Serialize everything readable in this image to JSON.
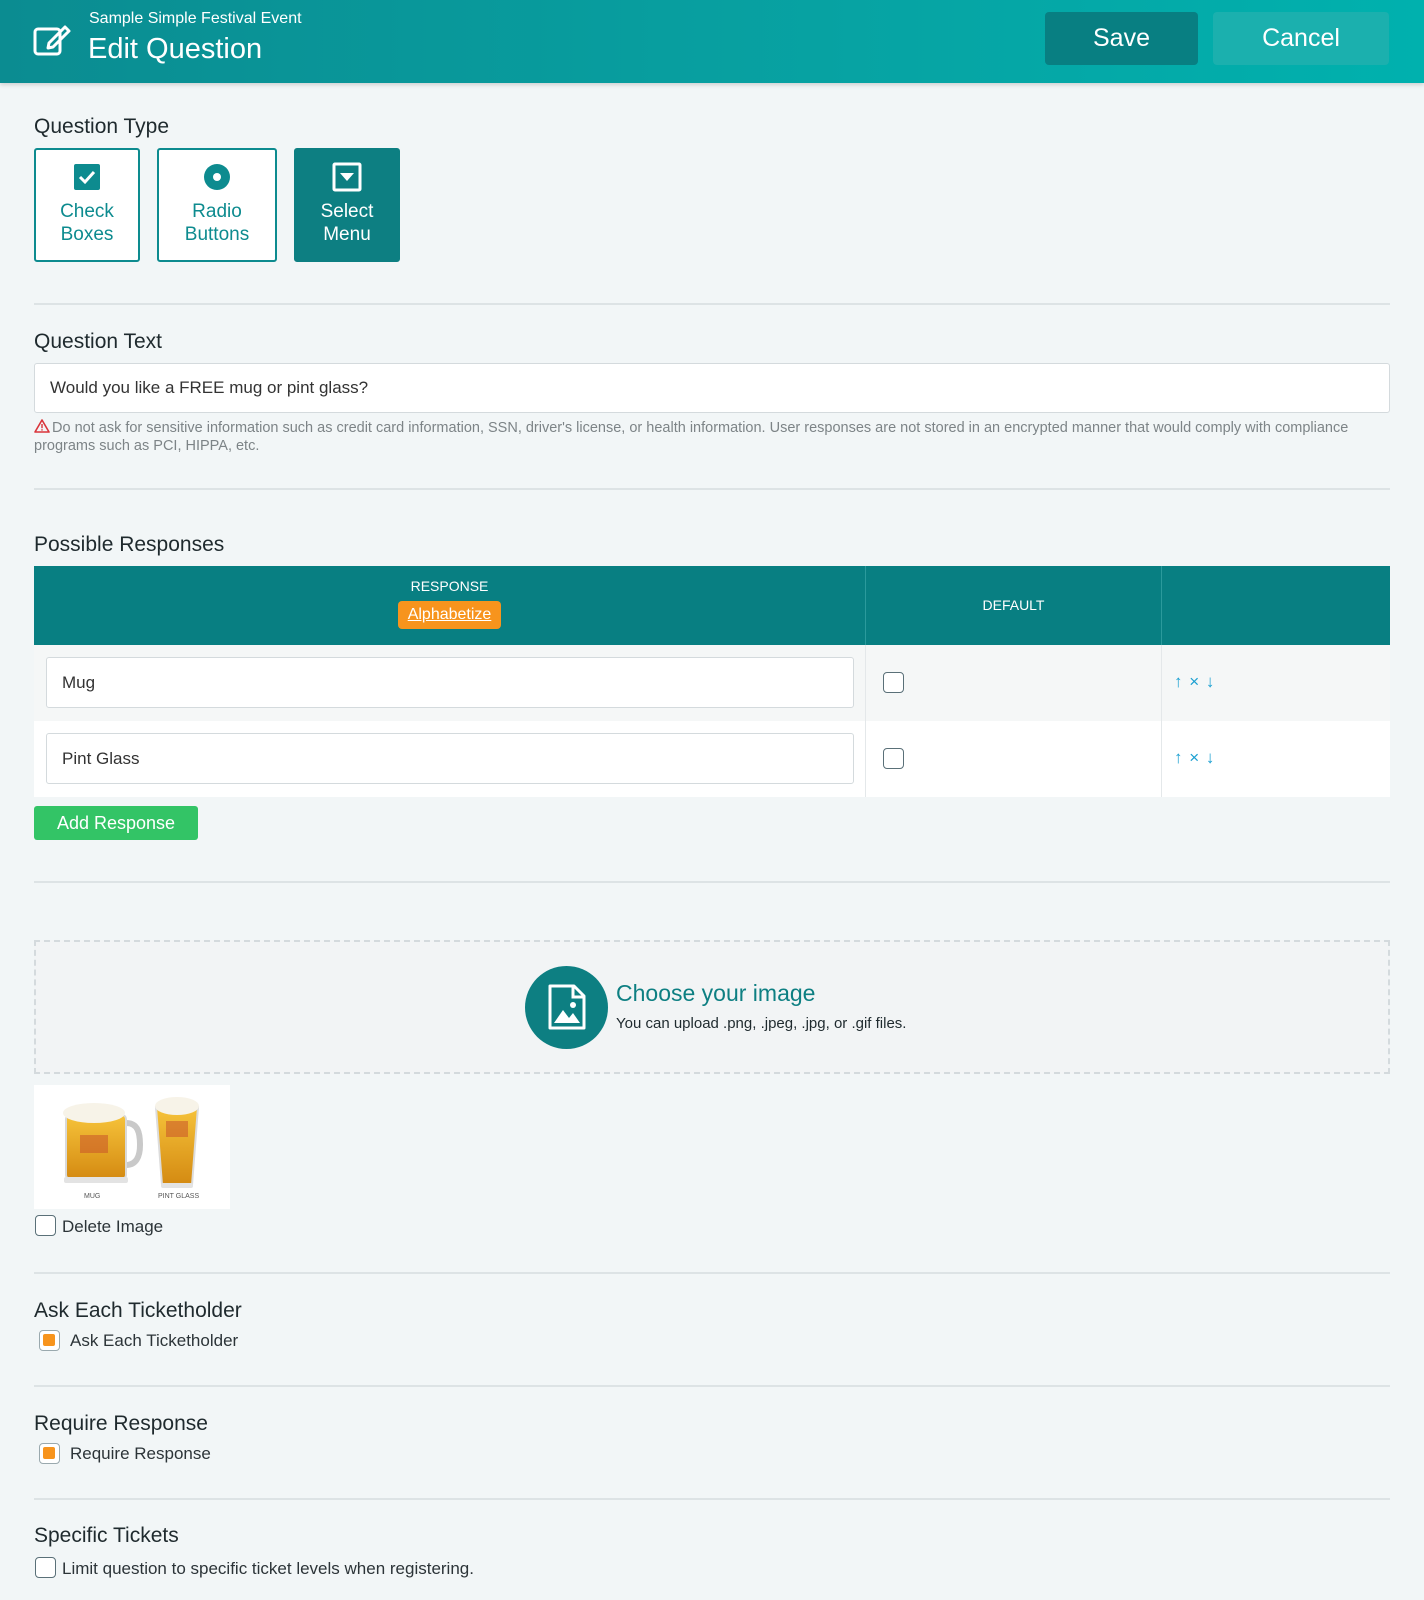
{
  "header": {
    "event_name": "Sample Simple Festival Event",
    "title": "Edit Question",
    "save_label": "Save",
    "cancel_label": "Cancel",
    "edit_icon": "edit-icon"
  },
  "question_type": {
    "heading": "Question Type",
    "options": [
      {
        "line1": "Check",
        "line2": "Boxes",
        "icon": "checkbox-icon",
        "selected": false
      },
      {
        "line1": "Radio",
        "line2": "Buttons",
        "icon": "radio-icon",
        "selected": false
      },
      {
        "line1": "Select",
        "line2": "Menu",
        "icon": "select-menu-icon",
        "selected": true
      }
    ]
  },
  "question_text": {
    "heading": "Question Text",
    "value": "Would you like a FREE mug or pint glass?",
    "warning": "Do not ask for sensitive information such as credit card information, SSN, driver's license, or health information. User responses are not stored in an encrypted manner that would comply with compliance programs such as PCI, HIPPA, etc."
  },
  "responses": {
    "heading": "Possible Responses",
    "col_response": "RESPONSE",
    "alphabetize_label": "Alphabetize",
    "col_default": "DEFAULT",
    "rows": [
      {
        "value": "Mug",
        "default": false,
        "actions": [
          "↑",
          "×",
          "↓"
        ]
      },
      {
        "value": "Pint Glass",
        "default": false,
        "actions": [
          "↑",
          "×",
          "↓"
        ]
      }
    ],
    "add_label": "Add Response"
  },
  "image": {
    "dropzone_title": "Choose your image",
    "dropzone_sub": "You can upload .png, .jpeg, .jpg, or .gif files.",
    "thumb_label_mug": "MUG",
    "thumb_label_pint": "PINT GLASS",
    "delete_label": "Delete Image",
    "delete_checked": false
  },
  "ask_each": {
    "heading": "Ask Each Ticketholder",
    "label": "Ask Each Ticketholder",
    "checked": true
  },
  "require": {
    "heading": "Require Response",
    "label": "Require Response",
    "checked": true
  },
  "specific": {
    "heading": "Specific Tickets",
    "label": "Limit question to specific ticket levels when registering.",
    "checked": false
  },
  "colors": {
    "brand_teal": "#087f82",
    "accent_orange": "#f7941d",
    "add_green": "#33c466",
    "action_blue": "#1a9fd1"
  }
}
